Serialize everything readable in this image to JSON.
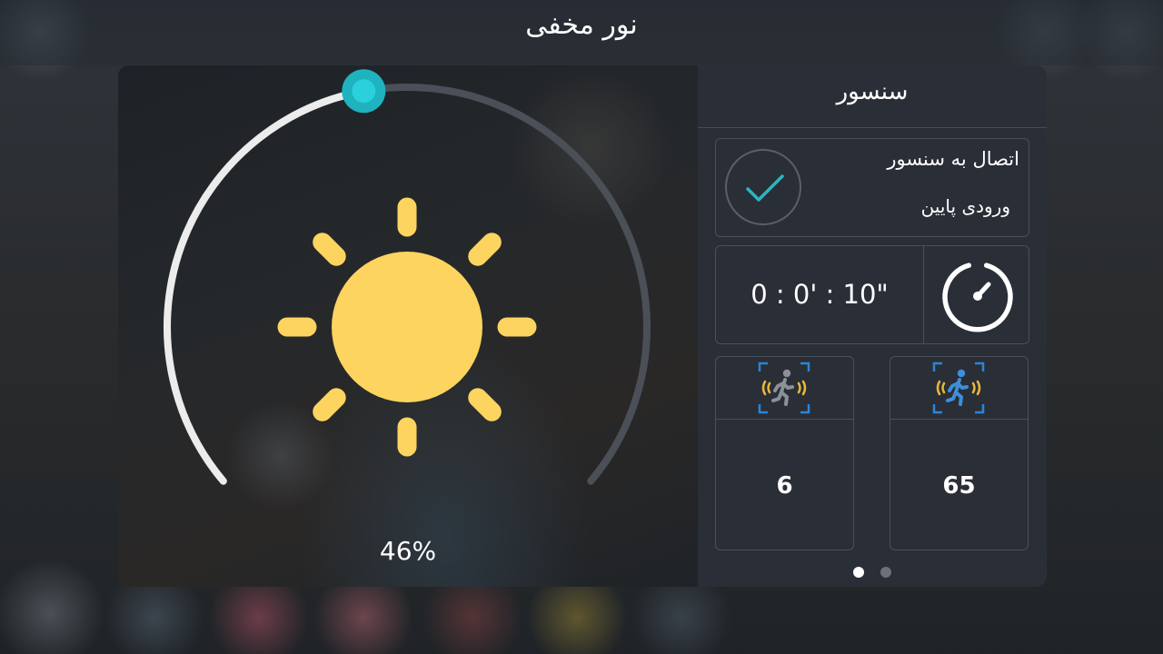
{
  "header": {
    "title": "نور مخفی"
  },
  "gauge": {
    "value_percent": 46,
    "label": "46%",
    "track_color": "#4b4f57",
    "fill_color": "#ececec",
    "knob_color": "#1eb3bf",
    "icon": "sun-icon",
    "icon_color": "#fcd45f"
  },
  "sensor": {
    "title": "سنسور",
    "connection": {
      "label": "اتصال به سنسور",
      "input": "ورودی پایین",
      "status_icon": "checkmark-icon",
      "check_color": "#2bb5c3"
    },
    "timer": {
      "value": "0 : 0' : 10\"",
      "icon": "stopwatch-icon"
    },
    "motion": [
      {
        "icon": "motion-sensor-inactive-icon",
        "value": "6",
        "figure_color": "#8c9199"
      },
      {
        "icon": "motion-sensor-active-icon",
        "value": "65",
        "figure_color": "#3f8fd8"
      }
    ],
    "pager": {
      "pages": 2,
      "active": 1
    }
  }
}
